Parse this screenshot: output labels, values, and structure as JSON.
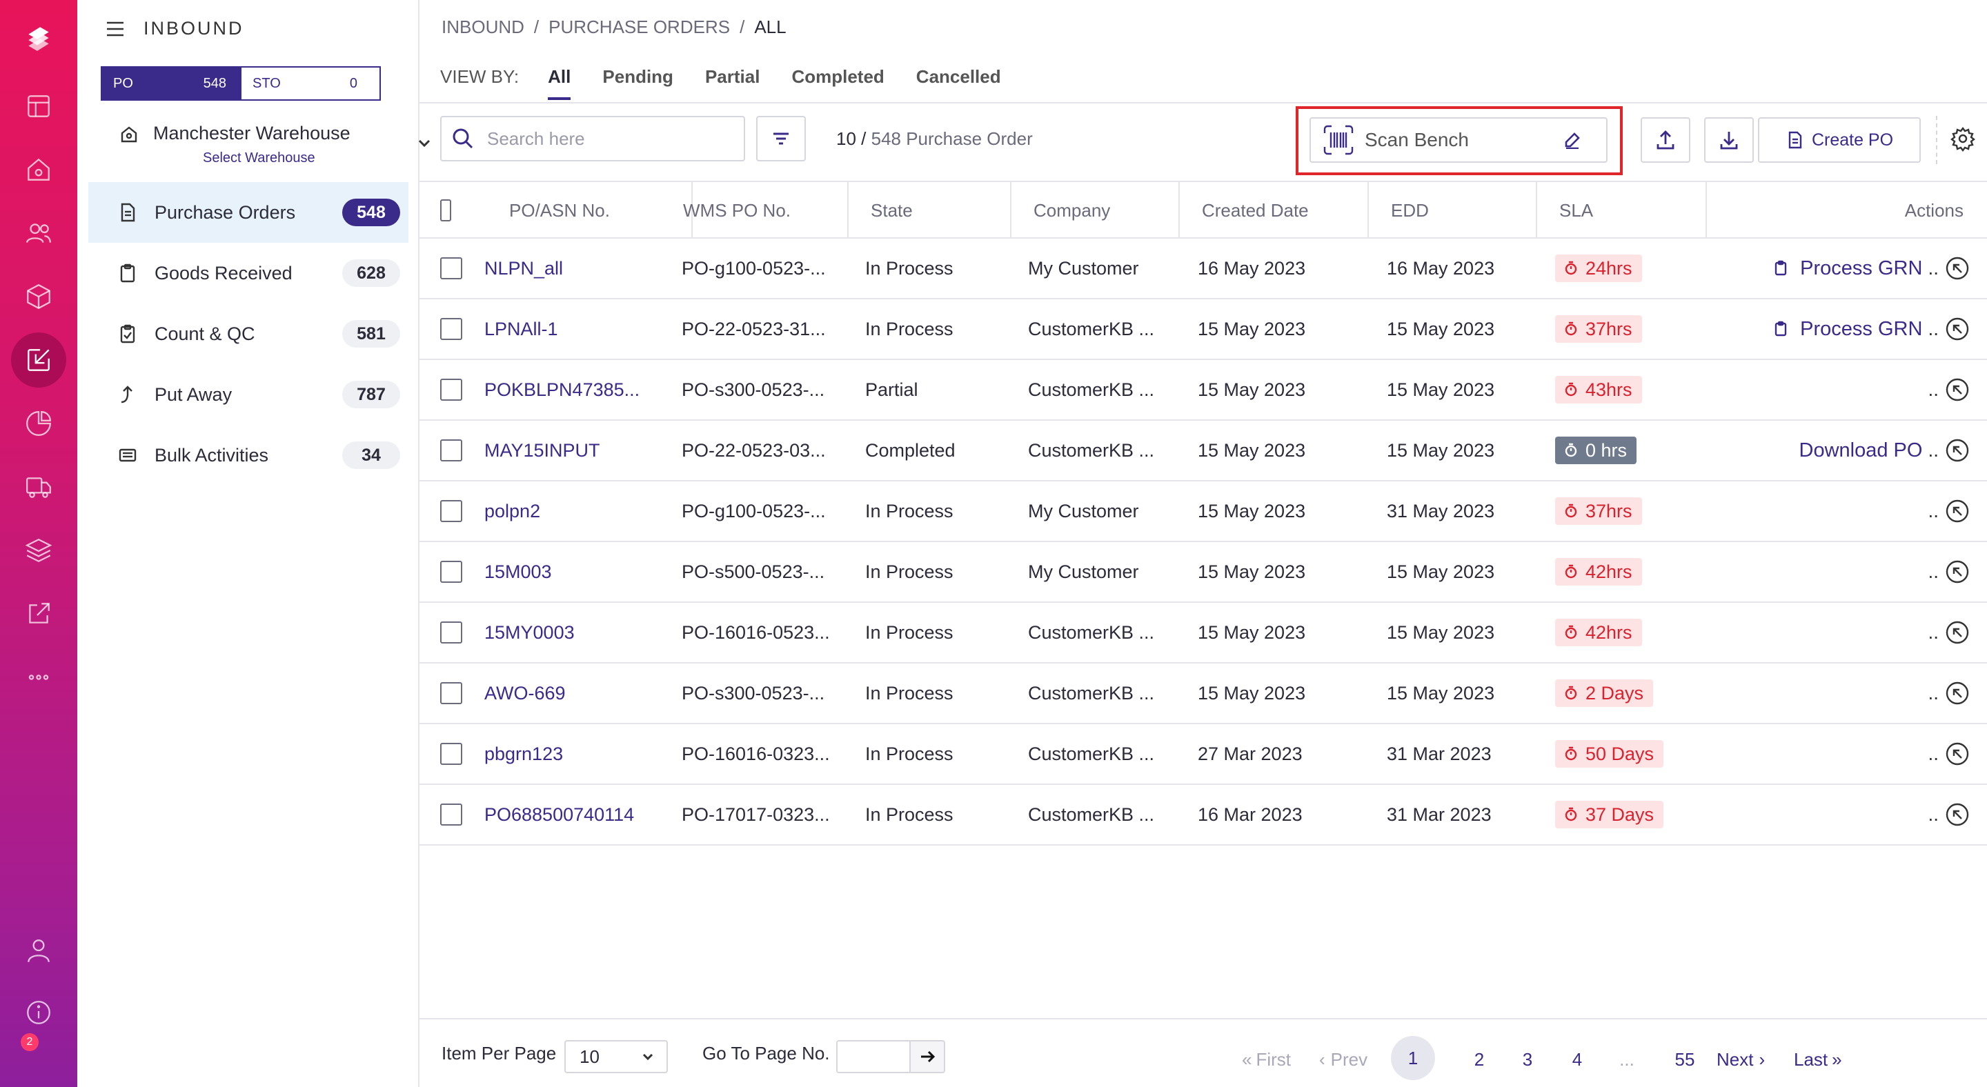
{
  "app": {
    "section_title": "INBOUND"
  },
  "rail": {
    "icons": [
      "logo-icon",
      "dashboard-icon",
      "home-icon",
      "users-icon",
      "box-icon",
      "inbound-icon",
      "reports-icon",
      "truck-icon",
      "layers-icon",
      "external-icon",
      "more-icon",
      "profile-icon",
      "info-icon"
    ],
    "notification_badge": "2"
  },
  "sidebar": {
    "segment": {
      "po_label": "PO",
      "po_count": "548",
      "sto_label": "STO",
      "sto_count": "0"
    },
    "warehouse": {
      "name": "Manchester Warehouse",
      "action": "Select Warehouse"
    },
    "items": [
      {
        "label": "Purchase Orders",
        "count": "548",
        "icon": "document-icon"
      },
      {
        "label": "Goods Received",
        "count": "628",
        "icon": "clipboard-icon"
      },
      {
        "label": "Count & QC",
        "count": "581",
        "icon": "clipboard-check-icon"
      },
      {
        "label": "Put Away",
        "count": "787",
        "icon": "arrow-up-icon"
      },
      {
        "label": "Bulk Activities",
        "count": "34",
        "icon": "list-icon"
      }
    ]
  },
  "breadcrumb": {
    "items": [
      "INBOUND",
      "/",
      "PURCHASE ORDERS",
      "/",
      "ALL"
    ]
  },
  "view_by": {
    "label": "VIEW BY:",
    "tabs": [
      "All",
      "Pending",
      "Partial",
      "Completed",
      "Cancelled"
    ],
    "active": "All"
  },
  "toolbar": {
    "search_placeholder": "Search here",
    "count_shown": "10 /",
    "count_total": "548 Purchase Order",
    "scan_label": "Scan Bench",
    "create_label": "Create PO"
  },
  "table": {
    "headers": [
      "PO/ASN No.",
      "WMS PO No.",
      "State",
      "Company",
      "Created Date",
      "EDD",
      "SLA",
      "Actions"
    ],
    "rows": [
      {
        "po": "NLPN_all",
        "wms": "PO-g100-0523-...",
        "state": "In Process",
        "company": "My Customer",
        "created": "16 May 2023",
        "edd": "16 May 2023",
        "sla": "24hrs",
        "action": "Process GRN"
      },
      {
        "po": "LPNAll-1",
        "wms": "PO-22-0523-31...",
        "state": "In Process",
        "company": "CustomerKB ...",
        "created": "15 May 2023",
        "edd": "15 May 2023",
        "sla": "37hrs",
        "action": "Process GRN"
      },
      {
        "po": "POKBLPN47385...",
        "wms": "PO-s300-0523-...",
        "state": "Partial",
        "company": "CustomerKB ...",
        "created": "15 May 2023",
        "edd": "15 May 2023",
        "sla": "43hrs",
        "action": ""
      },
      {
        "po": "MAY15INPUT",
        "wms": "PO-22-0523-03...",
        "state": "Completed",
        "company": "CustomerKB ...",
        "created": "15 May 2023",
        "edd": "15 May 2023",
        "sla": "0 hrs",
        "action": "Download PO"
      },
      {
        "po": "polpn2",
        "wms": "PO-g100-0523-...",
        "state": "In Process",
        "company": "My Customer",
        "created": "15 May 2023",
        "edd": "31 May 2023",
        "sla": "37hrs",
        "action": ""
      },
      {
        "po": "15M003",
        "wms": "PO-s500-0523-...",
        "state": "In Process",
        "company": "My Customer",
        "created": "15 May 2023",
        "edd": "15 May 2023",
        "sla": "42hrs",
        "action": ""
      },
      {
        "po": "15MY0003",
        "wms": "PO-16016-0523...",
        "state": "In Process",
        "company": "CustomerKB ...",
        "created": "15 May 2023",
        "edd": "15 May 2023",
        "sla": "42hrs",
        "action": ""
      },
      {
        "po": "AWO-669",
        "wms": "PO-s300-0523-...",
        "state": "In Process",
        "company": "CustomerKB ...",
        "created": "15 May 2023",
        "edd": "15 May 2023",
        "sla": "2 Days",
        "action": ""
      },
      {
        "po": "pbgrn123",
        "wms": "PO-16016-0323...",
        "state": "In Process",
        "company": "CustomerKB ...",
        "created": "27 Mar 2023",
        "edd": "31 Mar 2023",
        "sla": "50 Days",
        "action": ""
      },
      {
        "po": "PO688500740114",
        "wms": "PO-17017-0323...",
        "state": "In Process",
        "company": "CustomerKB ...",
        "created": "16 Mar 2023",
        "edd": "31 Mar 2023",
        "sla": "37 Days",
        "action": ""
      }
    ],
    "more_label": ".."
  },
  "footer": {
    "items_per_page_label": "Item Per Page",
    "items_per_page_value": "10",
    "goto_label": "Go To Page No.",
    "first": "First",
    "prev": "Prev",
    "pages": [
      "1",
      "2",
      "3",
      "4",
      "...",
      "55"
    ],
    "current_page": "1",
    "next": "Next",
    "last": "Last"
  },
  "colors": {
    "brand": "#3a2a8a",
    "rail_top": "#e8145a",
    "rail_bottom": "#8e1f9c",
    "sla_red_bg": "#fde3e4",
    "sla_red_fg": "#d8232f",
    "sla_grey": "#6f7a8c",
    "highlight": "#e0262b"
  }
}
